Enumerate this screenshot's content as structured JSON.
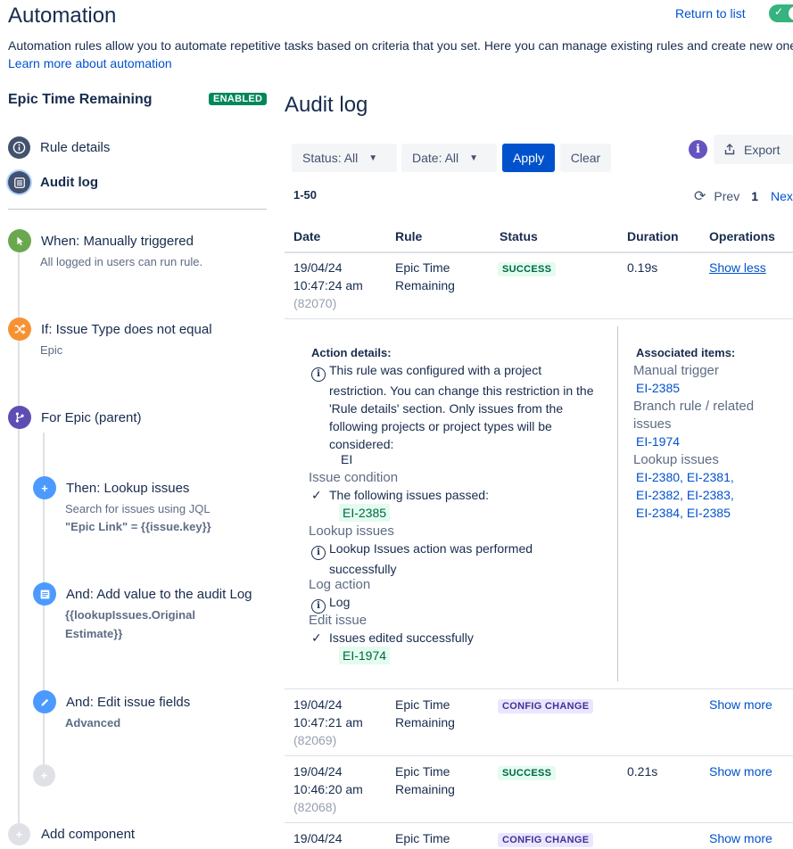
{
  "header": {
    "title": "Automation",
    "return_link": "Return to list",
    "intro": "Automation rules allow you to automate repetitive tasks based on criteria that you set. Here you can manage existing rules and create new ones.",
    "learn_more": "Learn more about automation"
  },
  "rule": {
    "name": "Epic Time Remaining",
    "status_badge": "ENABLED",
    "nav": [
      {
        "label": "Rule details",
        "icon": "info-icon"
      },
      {
        "label": "Audit log",
        "icon": "list-icon"
      }
    ],
    "components": [
      {
        "title": "When: Manually triggered",
        "subtitle": "All logged in users can run rule.",
        "icon": "cursor-click-icon",
        "color": "#6aa84f"
      },
      {
        "title": "If: Issue Type does not equal",
        "subtitle": "Epic",
        "icon": "shuffle-icon",
        "color": "#f79232"
      },
      {
        "title": "For Epic (parent)",
        "icon": "branch-icon",
        "color": "#5e4db2"
      },
      {
        "title": "Then: Lookup issues",
        "subtitle": "Search for issues using JQL",
        "detail": "\"Epic Link\" = {{issue.key}}",
        "icon": "plus-icon",
        "color": "#4c9aff"
      },
      {
        "title": "And: Add value to the audit Log",
        "detail_lines": [
          "{{lookupIssues.Original",
          "Estimate}}"
        ],
        "icon": "log-icon",
        "color": "#4c9aff"
      },
      {
        "title": "And: Edit issue fields",
        "detail": "Advanced",
        "icon": "pencil-icon",
        "color": "#4c9aff"
      }
    ],
    "add_component": "Add component"
  },
  "audit": {
    "title": "Audit log",
    "filters": {
      "status": "Status: All",
      "date": "Date: All",
      "apply": "Apply",
      "clear": "Clear"
    },
    "export": "Export",
    "range": "1-50",
    "pager": {
      "prev": "Prev",
      "current": "1",
      "next": "Next"
    },
    "columns": [
      "Date",
      "Rule",
      "Status",
      "Duration",
      "Operations"
    ],
    "rows": [
      {
        "date": "19/04/24",
        "time": "10:47:24 am",
        "id": "(82070)",
        "rule1": "Epic Time",
        "rule2": "Remaining",
        "status": "SUCCESS",
        "duration": "0.19s",
        "op": "Show less"
      },
      {
        "date": "19/04/24",
        "time": "10:47:21 am",
        "id": "(82069)",
        "rule1": "Epic Time",
        "rule2": "Remaining",
        "status": "CONFIG CHANGE",
        "duration": "",
        "op": "Show more"
      },
      {
        "date": "19/04/24",
        "time": "10:46:20 am",
        "id": "(82068)",
        "rule1": "Epic Time",
        "rule2": "Remaining",
        "status": "SUCCESS",
        "duration": "0.21s",
        "op": "Show more"
      },
      {
        "date": "19/04/24",
        "rule1": "Epic Time",
        "status": "CONFIG CHANGE",
        "op": "Show more"
      }
    ],
    "details": {
      "action_heading": "Action details:",
      "restriction_lines": [
        "This rule was configured with a project",
        "restriction. You can change this restriction in the",
        "'Rule details' section. Only issues from the",
        "following projects or project types will be",
        "considered:"
      ],
      "project": "EI",
      "issue_condition": "Issue condition",
      "passed": "The following issues passed:",
      "passed_issue": "EI-2385",
      "lookup": "Lookup issues",
      "lookup_lines": [
        "Lookup Issues action was performed",
        "successfully"
      ],
      "log_action": "Log action",
      "log": "Log",
      "edit_issue": "Edit issue",
      "edited": "Issues edited successfully",
      "edited_issue": "EI-1974",
      "assoc_heading": "Associated items:",
      "manual_trigger": "Manual trigger",
      "manual_issue": "EI-2385",
      "branch_rule_lines": [
        "Branch rule / related",
        "issues"
      ],
      "branch_issue": "EI-1974",
      "lookup_label": "Lookup issues",
      "lookup_issues": [
        "EI-2380",
        "EI-2381",
        "EI-2382",
        "EI-2383",
        "EI-2384",
        "EI-2385"
      ]
    }
  }
}
